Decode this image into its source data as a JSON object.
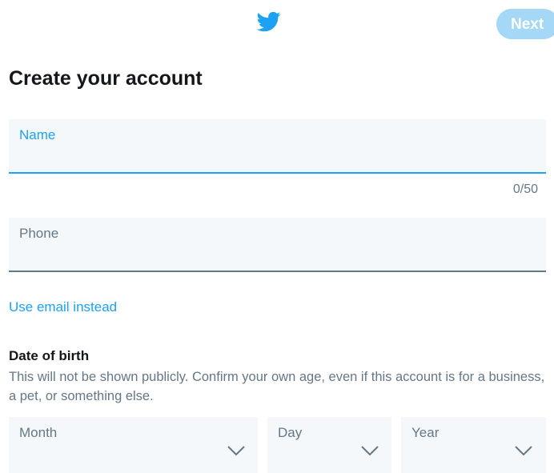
{
  "header": {
    "logo_icon": "bird-logo-icon",
    "next_label": "Next",
    "brand_color": "#1da1f2",
    "next_disabled_color": "#a5d7f7"
  },
  "page": {
    "title": "Create your account"
  },
  "form": {
    "name": {
      "label": "Name",
      "counter": "0/50",
      "value": ""
    },
    "phone": {
      "label": "Phone",
      "value": ""
    },
    "use_email_link": "Use email instead",
    "dob": {
      "heading": "Date of birth",
      "description": "This will not be shown publicly. Confirm your own age, even if this account is for a business, a pet, or something else.",
      "month_label": "Month",
      "day_label": "Day",
      "year_label": "Year",
      "chevron_icon": "chevron-down-icon"
    }
  }
}
